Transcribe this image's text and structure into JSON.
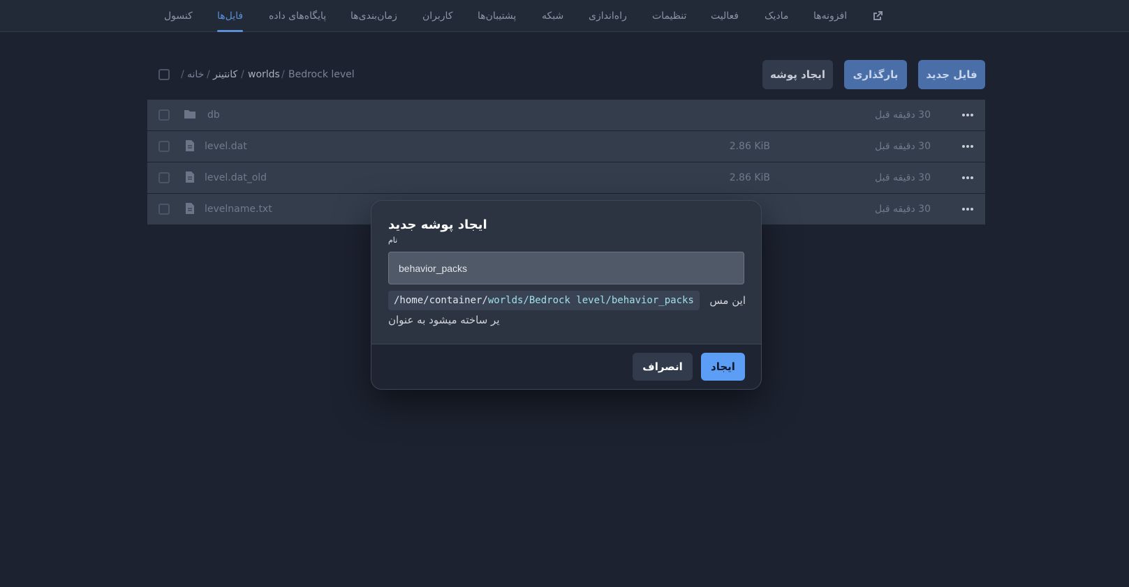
{
  "nav": {
    "tabs": [
      {
        "label": "کنسول",
        "active": false
      },
      {
        "label": "فایل‌ها",
        "active": true
      },
      {
        "label": "پایگاه‌های داده",
        "active": false
      },
      {
        "label": "زمان‌بندی‌ها",
        "active": false
      },
      {
        "label": "کاربران",
        "active": false
      },
      {
        "label": "پشتیبان‌ها",
        "active": false
      },
      {
        "label": "شبکه",
        "active": false
      },
      {
        "label": "راه‌اندازی",
        "active": false
      },
      {
        "label": "تنظیمات",
        "active": false
      },
      {
        "label": "فعالیت",
        "active": false
      },
      {
        "label": "مادیک",
        "active": false
      },
      {
        "label": "افزونه‌ها",
        "active": false
      }
    ],
    "external_icon": "external-link-icon"
  },
  "breadcrumb": {
    "items": [
      "خانه",
      "کانتینر",
      "worlds",
      "Bedrock level"
    ]
  },
  "actions": {
    "create_folder": "ایجاد پوشه",
    "upload": "بارگذاری",
    "new_file": "فایل جدید"
  },
  "files": [
    {
      "name": "db",
      "size": "",
      "modified": "30 دقیقه قبل",
      "icon": "folder-icon"
    },
    {
      "name": "level.dat",
      "size": "2.86 KiB",
      "modified": "30 دقیقه قبل",
      "icon": "file-icon"
    },
    {
      "name": "level.dat_old",
      "size": "2.86 KiB",
      "modified": "30 دقیقه قبل",
      "icon": "file-icon"
    },
    {
      "name": "levelname.txt",
      "size": "",
      "modified": "30 دقیقه قبل",
      "icon": "file-icon"
    }
  ],
  "modal": {
    "title": "ایجاد پوشه جدید",
    "name_label": "نام",
    "input_value": "behavior_packs",
    "path_prefix_text": "این مس",
    "path_base": "/home/container/",
    "path_relative": "worlds/Bedrock level/behavior_packs",
    "path_suffix_text": "یر ساخته میشود به عنوان",
    "cancel_label": "انصراف",
    "create_label": "ایجاد"
  },
  "colors": {
    "background": "#1c2230",
    "accent": "#5b8fd6",
    "primary_button": "#5c9ef6"
  }
}
